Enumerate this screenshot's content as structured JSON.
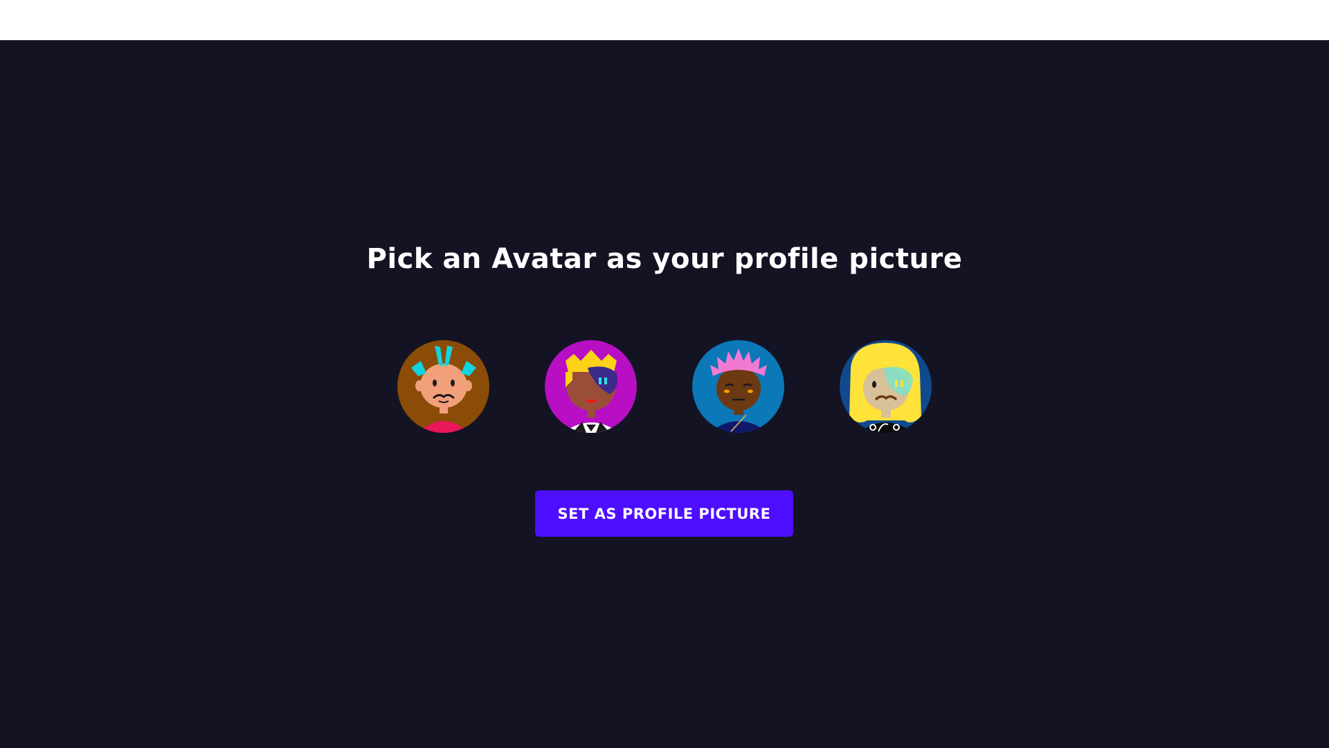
{
  "page": {
    "title": "Pick an Avatar as your profile picture",
    "button_label": "SET AS PROFILE PICTURE"
  },
  "colors": {
    "background": "#131324",
    "accent": "#4e0eff",
    "top_bar": "#ffffff"
  },
  "avatars": [
    {
      "name": "avatar-1",
      "icon": "mohawk-avatar-icon",
      "bg": "#8a4c06"
    },
    {
      "name": "avatar-2",
      "icon": "crown-avatar-icon",
      "bg": "#b80ec4"
    },
    {
      "name": "avatar-3",
      "icon": "pink-hair-avatar-icon",
      "bg": "#0b78b8"
    },
    {
      "name": "avatar-4",
      "icon": "blonde-avatar-icon",
      "bg": "#104a8e"
    }
  ]
}
